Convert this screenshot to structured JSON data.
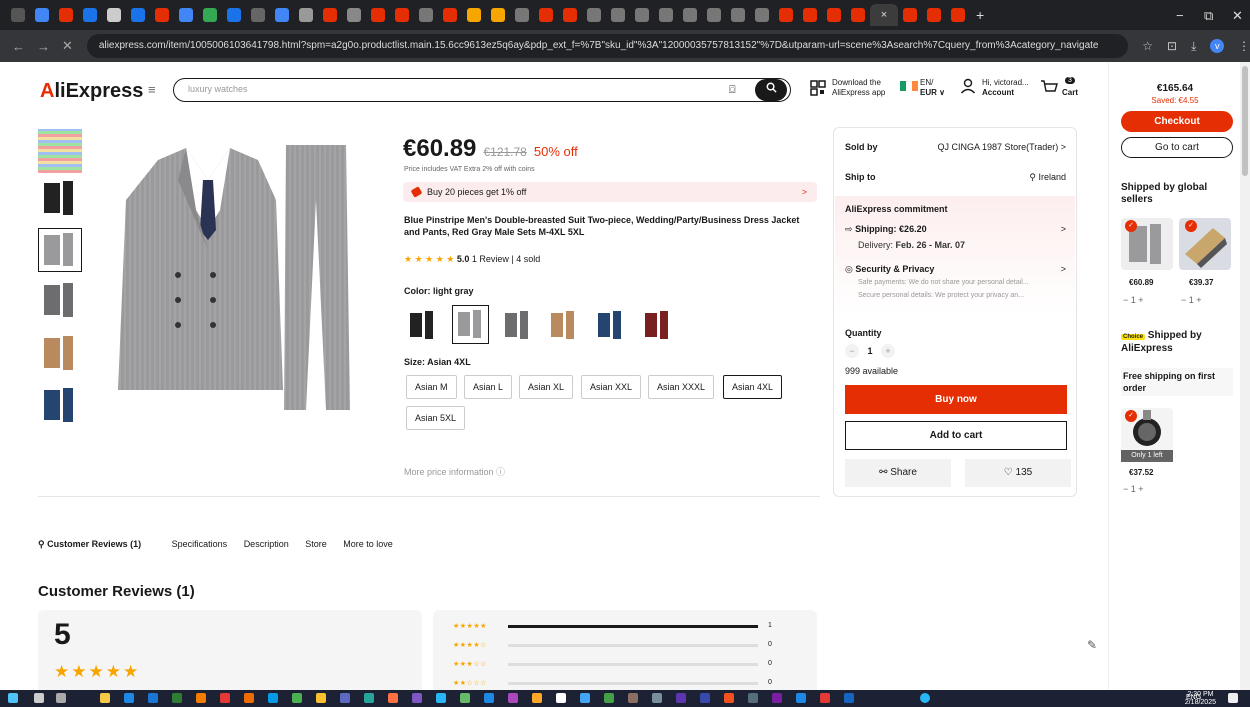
{
  "browser": {
    "url": "aliexpress.com/item/1005006103641798.html?spm=a2g0o.productlist.main.15.6cc9613ez5q6ay&pdp_ext_f=%7B\"sku_id\"%3A\"12000035757813152\"%7D&utparam-url=scene%3Asearch%7Cquery_from%3Acategory_navigate",
    "tab_close": "×",
    "new_tab": "+",
    "window_controls": [
      "−",
      "⧉",
      "✕"
    ],
    "nav_icons": [
      "←",
      "→",
      "✕"
    ],
    "ext_icons": [
      "☆",
      "⊡",
      "⤓",
      "v",
      "⋮"
    ]
  },
  "header": {
    "logo_prefix": "A",
    "logo_rest": "liExpress",
    "menu_icon": "≡",
    "search_placeholder": "luxury watches",
    "camera_icon": "⌼",
    "search_icon": "🔍",
    "download_line1": "Download the",
    "download_line2": "AliExpress app",
    "lang_line1": "EN/",
    "lang_line2": "EUR ∨",
    "account_line1": "Hi, victorad...",
    "account_line2": "Account",
    "cart_count": "3",
    "cart_label": "Cart"
  },
  "product": {
    "price": "€60.89",
    "old_price": "€121.78",
    "discount": "50% off",
    "vat_note": "Price includes VAT Extra 2% off with coins",
    "bundle": "Buy 20 pieces get 1% off",
    "bundle_chevron": ">",
    "title": "Blue Pinstripe Men's Double-breasted Suit Two-piece, Wedding/Party/Business Dress Jacket and Pants, Red Gray Male Sets M-4XL 5XL",
    "stars": "★ ★ ★ ★ ★",
    "rating": "5.0",
    "reviews": "1 Review",
    "sold": "4 sold",
    "color_label": "Color: light gray",
    "size_label": "Size: Asian 4XL",
    "sizes": [
      "Asian M",
      "Asian L",
      "Asian XL",
      "Asian XXL",
      "Asian XXXL",
      "Asian 4XL",
      "Asian 5XL"
    ],
    "more_price": "More price information ⓘ"
  },
  "buybox": {
    "sold_by_label": "Sold by",
    "store": "QJ CINGA 1987 Store(Trader) >",
    "ship_to_label": "Ship to",
    "ship_to": "⚲ Ireland",
    "commitment": "AliExpress commitment",
    "shipping": "Shipping: €26.20",
    "delivery_prefix": "Delivery: ",
    "delivery": "Feb. 26 - Mar. 07",
    "security": "Security & Privacy",
    "security_line1": "Safe payments: We do not share your personal detail...",
    "security_line2": "Secure personal details: We protect your privacy an...",
    "chevron": ">",
    "quantity_label": "Quantity",
    "minus": "−",
    "qty": "1",
    "plus": "+",
    "available": "999 available",
    "buy_now": "Buy now",
    "add_to_cart": "Add to cart",
    "share": "Share",
    "wishes": "135"
  },
  "tabs": [
    "Customer Reviews (1)",
    "Specifications",
    "Description",
    "Store",
    "More to love"
  ],
  "reviews": {
    "heading": "Customer Reviews (1)",
    "score": "5",
    "stars": "★★★★★",
    "rows": [
      {
        "stars": "★★★★★",
        "count": "1",
        "fill": 1.0
      },
      {
        "stars": "★★★★☆",
        "count": "0",
        "fill": 0
      },
      {
        "stars": "★★★☆☆",
        "count": "0",
        "fill": 0
      },
      {
        "stars": "★★☆☆☆",
        "count": "0",
        "fill": 0
      }
    ]
  },
  "sidebar": {
    "total": "€165.64",
    "saved": "Saved: €4.55",
    "checkout": "Checkout",
    "go_to_cart": "Go to cart",
    "global_heading": "Shipped by global sellers",
    "item1_price": "€60.89",
    "item2_price": "€39.37",
    "choice_badge": "Choice",
    "choice_heading": "Shipped by AliExpress",
    "free_shipping": "Free shipping on first order",
    "only_left": "Only 1 left",
    "item3_price": "€37.52",
    "qty_ctl": "−  1  +",
    "qty_ctl_single": "−  1  +",
    "check": "✓"
  },
  "taskbar": {
    "time": "2:30 PM",
    "date": "2/18/2025",
    "lang": "ENG"
  },
  "colors": {
    "brand_red": "#e62e04",
    "star": "#f7a600",
    "suit_gray": "#9a9a9c"
  }
}
